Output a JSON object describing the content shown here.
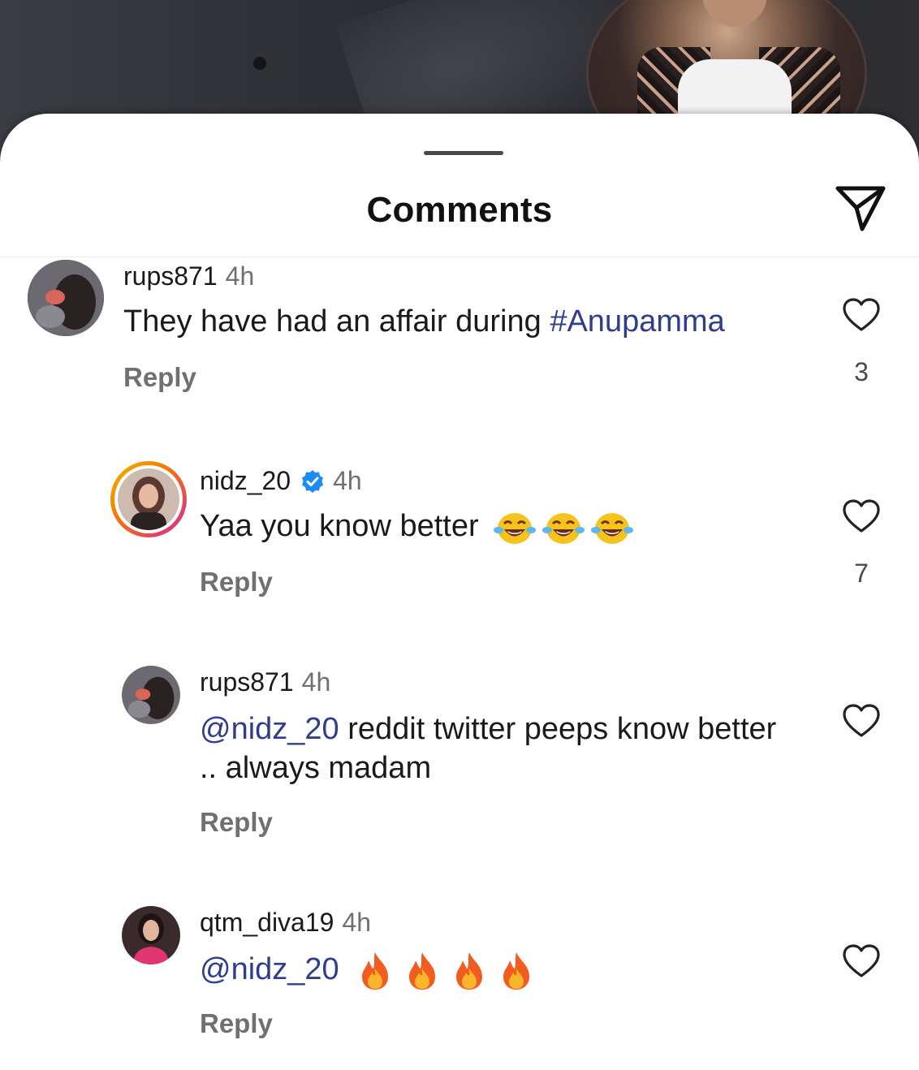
{
  "sheet": {
    "title": "Comments"
  },
  "comments": [
    {
      "username": "rups871",
      "time": "4h",
      "text": "They have had an affair during ",
      "hashtag": "#Anupamma",
      "reply_label": "Reply",
      "likes": "3"
    },
    {
      "username": "nidz_20",
      "time": "4h",
      "verified": true,
      "text": "Yaa you know better",
      "emojis": [
        "face-with-tears-of-joy",
        "face-with-tears-of-joy",
        "face-with-tears-of-joy"
      ],
      "reply_label": "Reply",
      "likes": "7"
    },
    {
      "username": "rups871",
      "time": "4h",
      "mention": "@nidz_20",
      "text": " reddit twitter peeps know better .. always madam",
      "reply_label": "Reply",
      "likes": ""
    },
    {
      "username": "qtm_diva19",
      "time": "4h",
      "mention": "@nidz_20",
      "emojis": [
        "fire",
        "fire",
        "fire",
        "fire"
      ],
      "reply_label": "Reply",
      "likes": ""
    }
  ],
  "icons": {
    "share": "paper-plane-icon",
    "like": "heart-outline-icon",
    "verified": "verified-badge-icon",
    "prev": "chevron-left-icon",
    "next": "chevron-right-icon"
  },
  "colors": {
    "mention": "#2f3d8c",
    "verified": "#1d8cf0",
    "muted": "#707070",
    "story_ring_start": "#f5b400",
    "story_ring_end": "#d6249f"
  }
}
